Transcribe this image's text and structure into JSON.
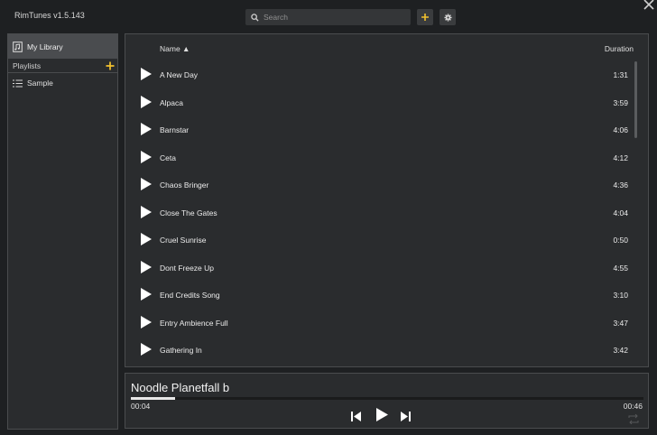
{
  "app": {
    "title": "RimTunes v1.5.143"
  },
  "search": {
    "placeholder": "Search",
    "value": ""
  },
  "sidebar": {
    "library_label": "My Library",
    "playlists_label": "Playlists",
    "playlists": [
      {
        "name": "Sample"
      }
    ]
  },
  "track_list": {
    "name_header": "Name ▲",
    "duration_header": "Duration",
    "tracks": [
      {
        "name": "A New Day",
        "duration": "1:31"
      },
      {
        "name": "Alpaca",
        "duration": "3:59"
      },
      {
        "name": "Barnstar",
        "duration": "4:06"
      },
      {
        "name": "Ceta",
        "duration": "4:12"
      },
      {
        "name": "Chaos Bringer",
        "duration": "4:36"
      },
      {
        "name": "Close The Gates",
        "duration": "4:04"
      },
      {
        "name": "Cruel Sunrise",
        "duration": "0:50"
      },
      {
        "name": "Dont Freeze Up",
        "duration": "4:55"
      },
      {
        "name": "End Credits Song",
        "duration": "3:10"
      },
      {
        "name": "Entry Ambience Full",
        "duration": "3:47"
      },
      {
        "name": "Gathering In",
        "duration": "3:42"
      }
    ]
  },
  "player": {
    "now_playing": "Noodle Planetfall b",
    "elapsed": "00:04",
    "total": "00:46",
    "progress_fraction": 0.087
  },
  "colors": {
    "accent_add": "#f2c12e",
    "background": "#1e2022",
    "panel": "#2a2c2e"
  }
}
